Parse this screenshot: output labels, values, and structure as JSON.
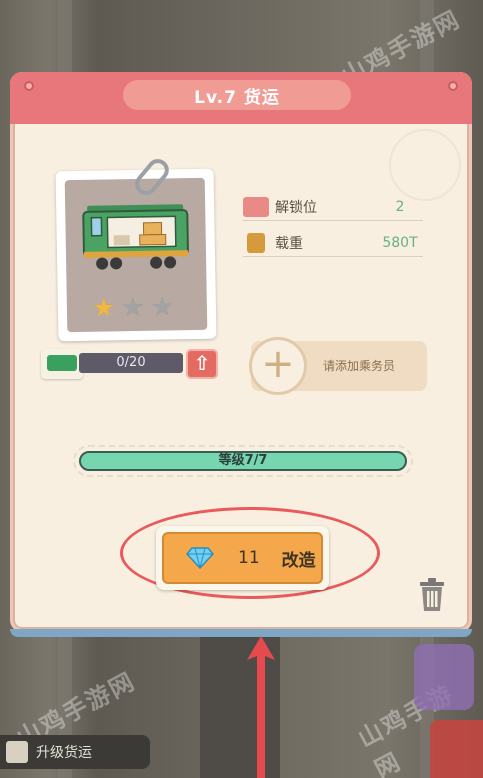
{
  "dialog": {
    "title": "Lv.7 货运",
    "train": {
      "stars_total": 3,
      "stars_filled": 1
    },
    "stats": [
      {
        "icon": "unlock-slot-icon",
        "label": "解锁位",
        "value": "2"
      },
      {
        "icon": "weight-icon",
        "label": "载重",
        "value": "580T"
      }
    ],
    "shards": {
      "progress_text": "0/20",
      "upgrade_icon": "arrow-up-icon"
    },
    "crew": {
      "add_label": "请添加乘务员"
    },
    "level": {
      "text": "等级7/7",
      "fraction": 1.0
    },
    "action": {
      "gem_icon": "diamond-icon",
      "cost": "11",
      "label": "改造"
    },
    "trash_icon": "trash-icon"
  },
  "background": {
    "watermark": "山鸡手游网",
    "bottom_tag": "升级货运"
  },
  "colors": {
    "header": "#e8777b",
    "panel": "#f8efe0",
    "action_button": "#f4a84b",
    "level_bar": "#75d6b0",
    "annotation": "#e85a5b"
  }
}
